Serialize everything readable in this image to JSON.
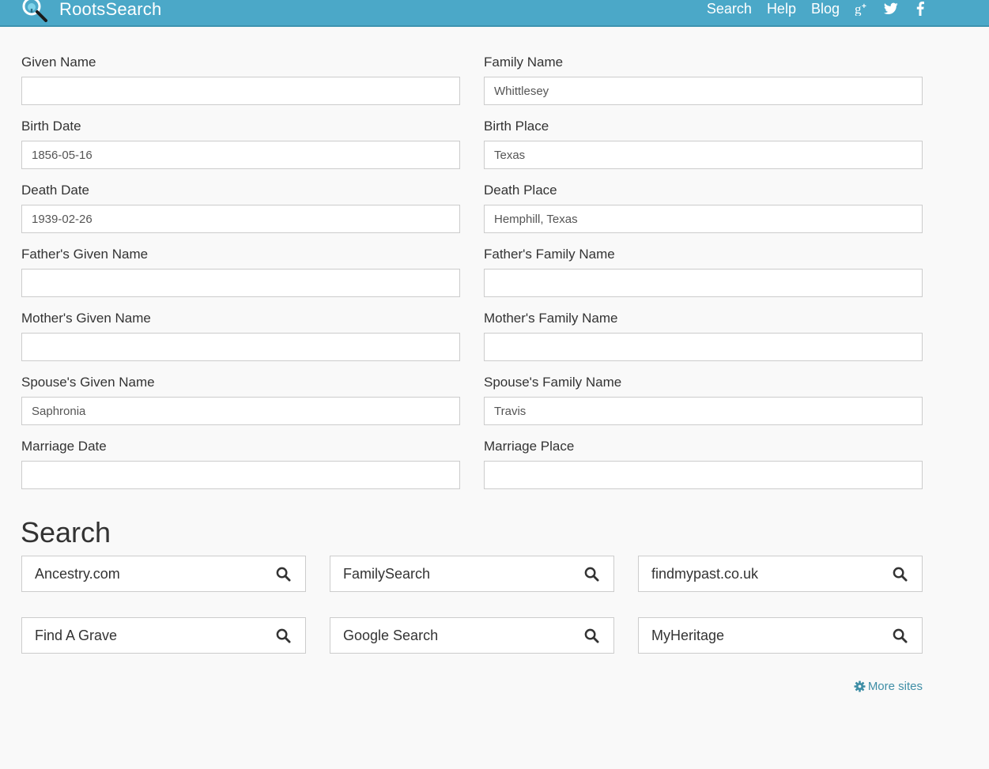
{
  "brand": {
    "name": "RootsSearch",
    "icon": "magnifier-tree-icon"
  },
  "nav": {
    "links": [
      "Search",
      "Help",
      "Blog"
    ],
    "social": [
      "google-plus-icon",
      "twitter-icon",
      "facebook-icon"
    ]
  },
  "colors": {
    "navbar": "#4ba8c8",
    "page_background": "#f9f9f9",
    "link": "#3f8ea6",
    "input_border": "#cccccc"
  },
  "form": {
    "given_name": {
      "label": "Given Name",
      "value": ""
    },
    "family_name": {
      "label": "Family Name",
      "value": "Whittlesey"
    },
    "birth_date": {
      "label": "Birth Date",
      "value": "1856-05-16"
    },
    "birth_place": {
      "label": "Birth Place",
      "value": "Texas"
    },
    "death_date": {
      "label": "Death Date",
      "value": "1939-02-26"
    },
    "death_place": {
      "label": "Death Place",
      "value": "Hemphill, Texas"
    },
    "father_given_name": {
      "label": "Father's Given Name",
      "value": ""
    },
    "father_family_name": {
      "label": "Father's Family Name",
      "value": ""
    },
    "mother_given_name": {
      "label": "Mother's Given Name",
      "value": ""
    },
    "mother_family_name": {
      "label": "Mother's Family Name",
      "value": ""
    },
    "spouse_given_name": {
      "label": "Spouse's Given Name",
      "value": "Saphronia"
    },
    "spouse_family_name": {
      "label": "Spouse's Family Name",
      "value": "Travis"
    },
    "marriage_date": {
      "label": "Marriage Date",
      "value": ""
    },
    "marriage_place": {
      "label": "Marriage Place",
      "value": ""
    }
  },
  "search": {
    "heading": "Search",
    "sites": [
      {
        "name": "Ancestry.com",
        "icon": "search-icon"
      },
      {
        "name": "FamilySearch",
        "icon": "search-icon"
      },
      {
        "name": "findmypast.co.uk",
        "icon": "search-icon"
      },
      {
        "name": "Find A Grave",
        "icon": "search-icon"
      },
      {
        "name": "Google Search",
        "icon": "search-icon"
      },
      {
        "name": "MyHeritage",
        "icon": "search-icon"
      }
    ],
    "more_sites": {
      "label": "More sites",
      "icon": "gear-icon"
    }
  }
}
